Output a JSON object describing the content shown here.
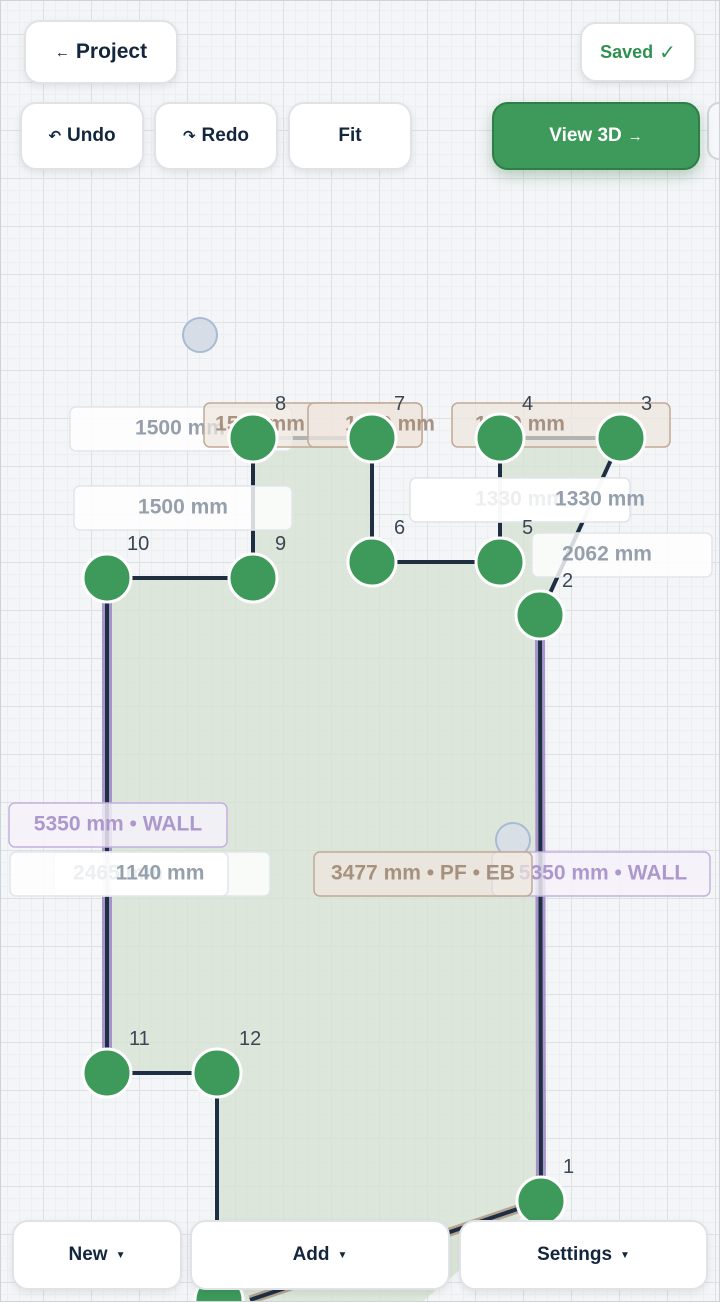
{
  "toolbar": {
    "back_label": "Project",
    "back_icon": "arrow-left",
    "saved_label": "Saved",
    "saved_icon": "check-mark",
    "undo_label": "Undo",
    "redo_label": "Redo",
    "fit_label": "Fit",
    "view3d_label": "View 3D",
    "view3d_icon": "arrow-right"
  },
  "bottom_bar": {
    "new_label": "New",
    "add_label": "Add",
    "settings_label": "Settings",
    "caret_icon": "caret-down"
  },
  "colors": {
    "node": "#3d9a5b",
    "wall_outline": "#9b85c4",
    "edge": "#1e2f44",
    "room_fill": "#d8e2d2",
    "tag_wall": "#a58ec9",
    "tag_pf": "#a48872",
    "tag_dim": "#8a96a3",
    "accent": "#3d9a5b"
  },
  "vertices": [
    {
      "id": "1",
      "label": "1"
    },
    {
      "id": "2",
      "label": "2"
    },
    {
      "id": "3",
      "label": "3"
    },
    {
      "id": "4",
      "label": "4"
    },
    {
      "id": "5",
      "label": "5"
    },
    {
      "id": "6",
      "label": "6"
    },
    {
      "id": "7",
      "label": "7"
    },
    {
      "id": "8",
      "label": "8"
    },
    {
      "id": "9",
      "label": "9"
    },
    {
      "id": "10",
      "label": "10"
    },
    {
      "id": "11",
      "label": "11"
    },
    {
      "id": "12",
      "label": "12"
    }
  ],
  "segments": [
    {
      "from": "1",
      "to": "2",
      "type": "wall"
    },
    {
      "from": "2",
      "to": "3",
      "type": "edge"
    },
    {
      "from": "3",
      "to": "4",
      "type": "edge"
    },
    {
      "from": "4",
      "to": "5",
      "type": "edge"
    },
    {
      "from": "5",
      "to": "6",
      "type": "edge"
    },
    {
      "from": "6",
      "to": "7",
      "type": "edge"
    },
    {
      "from": "7",
      "to": "8",
      "type": "edge"
    },
    {
      "from": "8",
      "to": "9",
      "type": "edge"
    },
    {
      "from": "9",
      "to": "10",
      "type": "edge"
    },
    {
      "from": "10",
      "to": "11",
      "type": "wall"
    },
    {
      "from": "11",
      "to": "12",
      "type": "edge"
    }
  ],
  "dimension_labels": [
    {
      "text": "1500 mm",
      "style": "dim"
    },
    {
      "text": "1500 mm",
      "style": "dim"
    },
    {
      "text": "1330 mm",
      "style": "dim"
    },
    {
      "text": "1330 mm",
      "style": "dim"
    },
    {
      "text": "2062 mm",
      "style": "dim"
    },
    {
      "text": "1500 mm",
      "style": "pf"
    },
    {
      "text": "1330 mm",
      "style": "pf"
    },
    {
      "text": "1330 mm",
      "style": "pf"
    },
    {
      "text": "5350 mm • WALL",
      "style": "wall"
    },
    {
      "text": "5350 mm • WALL",
      "style": "wall"
    },
    {
      "text": "2465 mm",
      "style": "dim"
    },
    {
      "text": "1140 mm",
      "style": "dim"
    },
    {
      "text": "3477 mm • PF • EB",
      "style": "pf"
    }
  ]
}
